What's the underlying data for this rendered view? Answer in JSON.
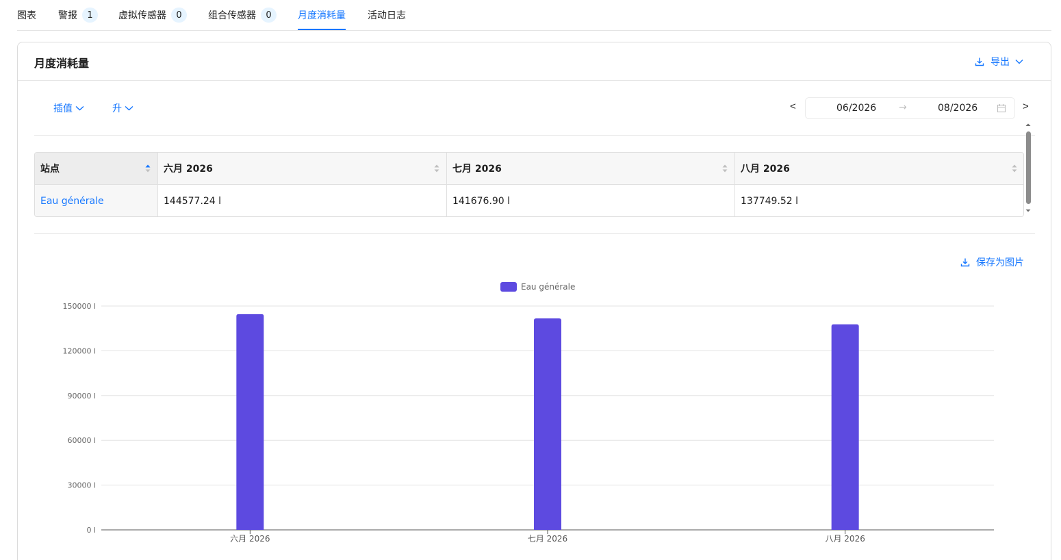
{
  "tabs": [
    {
      "label": "图表",
      "badge": null,
      "active": false
    },
    {
      "label": "警报",
      "badge": "1",
      "active": false
    },
    {
      "label": "虚拟传感器",
      "badge": "0",
      "active": false
    },
    {
      "label": "组合传感器",
      "badge": "0",
      "active": false
    },
    {
      "label": "月度消耗量",
      "badge": null,
      "active": true
    },
    {
      "label": "活动日志",
      "badge": null,
      "active": false
    }
  ],
  "card": {
    "title": "月度消耗量",
    "export_label": "导出"
  },
  "toolbar": {
    "interpolation_label": "插值",
    "sort_label": "升",
    "prev_label": "<",
    "next_label": ">",
    "date_from": "06/2026",
    "date_to": "08/2026",
    "range_separator": "→"
  },
  "table": {
    "columns": [
      "站点",
      "六月 2026",
      "七月 2026",
      "八月 2026"
    ],
    "rows": [
      {
        "site": "Eau générale",
        "values": [
          "144577.24 l",
          "141676.90 l",
          "137749.52 l"
        ]
      }
    ]
  },
  "save_image_label": "保存为图片",
  "colors": {
    "accent": "#1677ff",
    "bar": "#5d4ae0"
  },
  "chart_data": {
    "type": "bar",
    "categories": [
      "六月 2026",
      "七月 2026",
      "八月 2026"
    ],
    "series": [
      {
        "name": "Eau générale",
        "values": [
          144577.24,
          141676.9,
          137749.52
        ]
      }
    ],
    "ylim": [
      0,
      150000
    ],
    "yticks": [
      0,
      30000,
      60000,
      90000,
      120000,
      150000
    ],
    "ytick_labels": [
      "0 l",
      "30000 l",
      "60000 l",
      "90000 l",
      "120000 l",
      "150000 l"
    ],
    "legend_position": "top-center",
    "grid": true
  }
}
